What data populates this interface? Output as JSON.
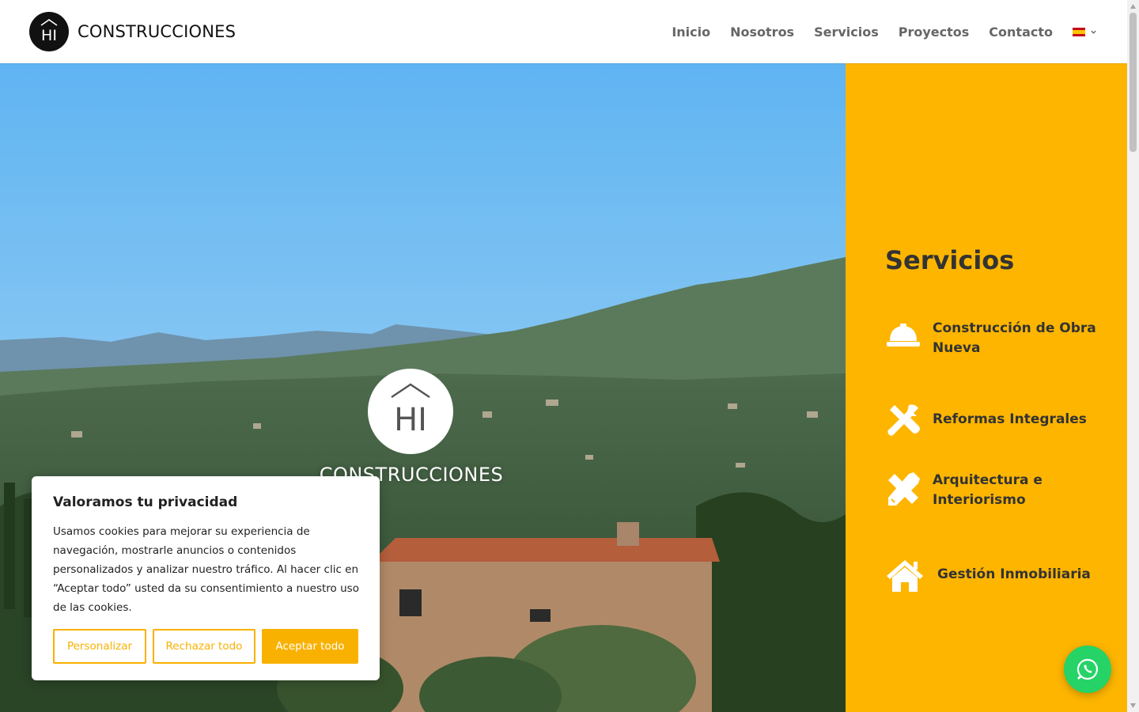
{
  "header": {
    "logo_text": "CONSTRUCCIONES",
    "logo_monogram": "HI",
    "nav": [
      "Inicio",
      "Nosotros",
      "Servicios",
      "Proyectos",
      "Contacto"
    ],
    "language_flag": "spain-flag-icon"
  },
  "hero": {
    "logo_text": "CONSTRUCCIONES",
    "logo_monogram": "HI"
  },
  "services": {
    "title": "Servicios",
    "items": [
      {
        "icon": "hard-hat-icon",
        "label": "Construcción de Obra Nueva"
      },
      {
        "icon": "tools-icon",
        "label": "Reformas Integrales"
      },
      {
        "icon": "pencil-ruler-icon",
        "label": "Arquitectura e Interiorismo"
      },
      {
        "icon": "home-icon",
        "label": "Gestión Inmobiliaria"
      }
    ]
  },
  "cookie": {
    "title": "Valoramos tu privacidad",
    "text": "Usamos cookies para mejorar su experiencia de navegación, mostrarle anuncios o contenidos personalizados y analizar nuestro tráfico. Al hacer clic en “Aceptar todo” usted da su consentimiento a nuestro uso de las cookies.",
    "buttons": {
      "customize": "Personalizar",
      "reject": "Rechazar todo",
      "accept": "Aceptar todo"
    }
  },
  "colors": {
    "accent": "#fdb500",
    "cookie_button": "#f9b100",
    "whatsapp": "#25d366",
    "nav_text": "#666666"
  }
}
